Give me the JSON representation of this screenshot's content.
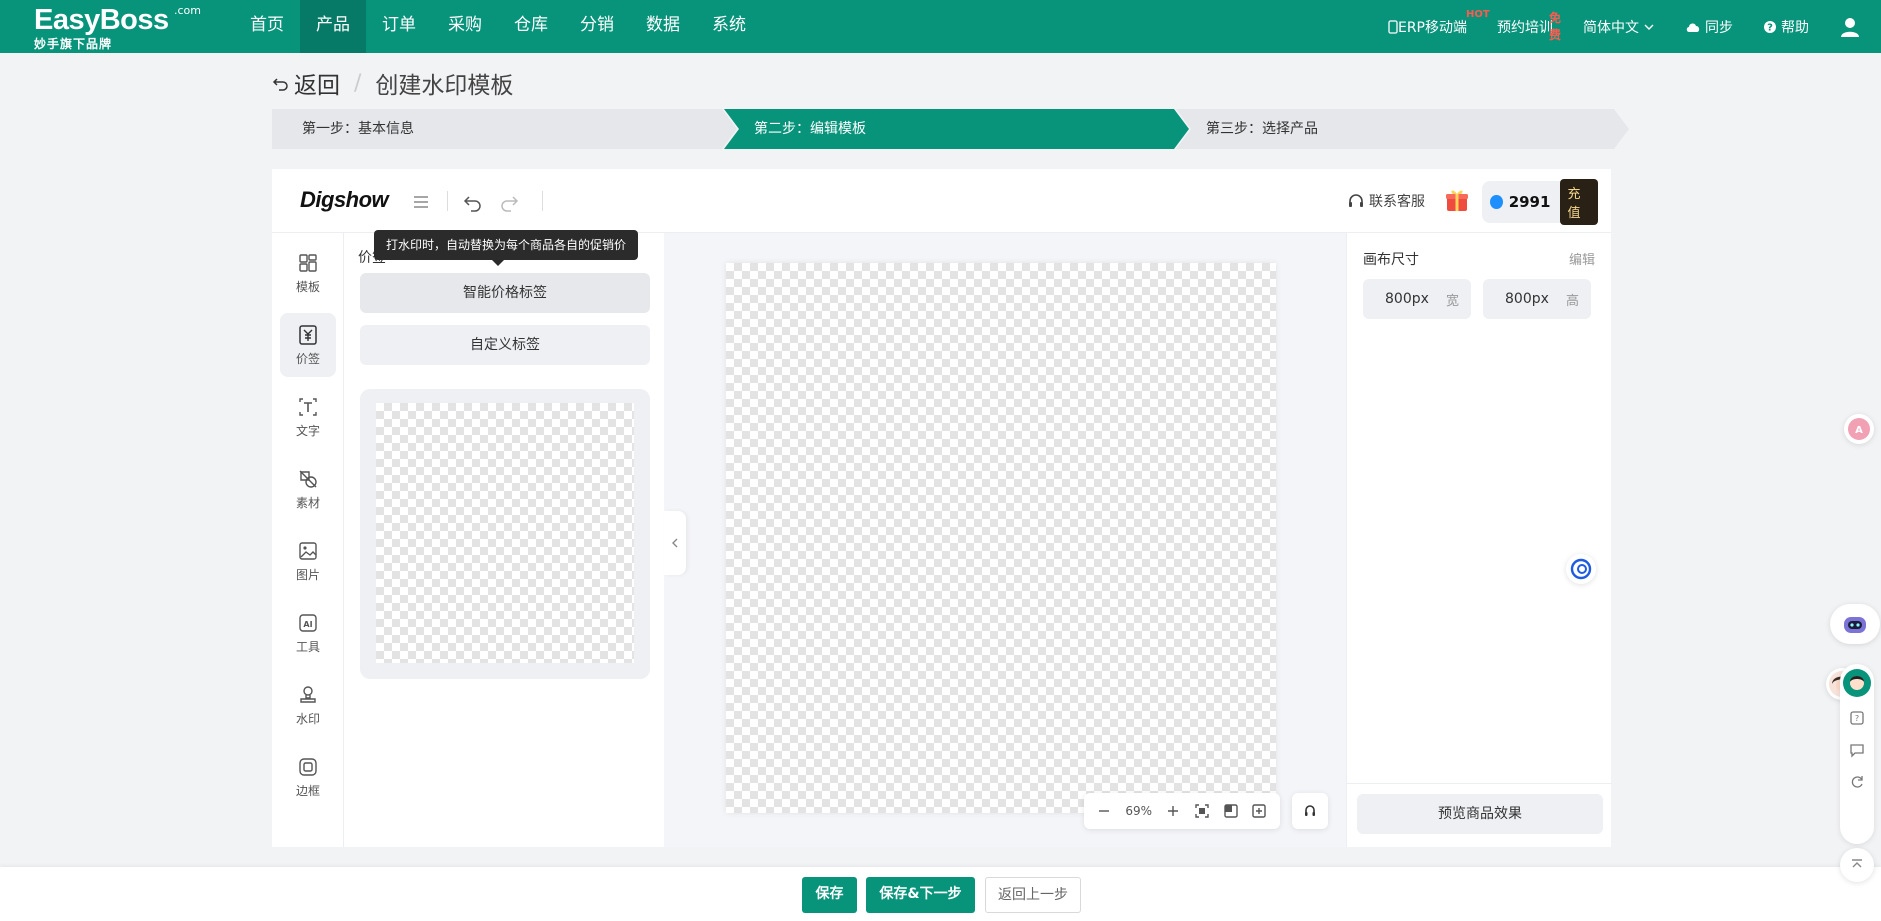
{
  "nav": {
    "logo": "EasyBoss",
    "logo_com": ".com",
    "logo_sub": "妙手旗下品牌",
    "items": [
      {
        "label": "首页"
      },
      {
        "label": "产品"
      },
      {
        "label": "订单"
      },
      {
        "label": "采购"
      },
      {
        "label": "仓库"
      },
      {
        "label": "分销"
      },
      {
        "label": "数据"
      },
      {
        "label": "系统"
      }
    ],
    "active_index": 1,
    "right": {
      "erp_mobile": "ERP移动端",
      "erp_badge": "HOT",
      "training": "预约培训",
      "training_badge": "免费",
      "language": "简体中文",
      "sync": "同步",
      "help": "帮助"
    }
  },
  "header": {
    "back": "返回",
    "separator": "/",
    "title": "创建水印模板"
  },
  "steps": [
    {
      "label": "第一步：基本信息"
    },
    {
      "label": "第二步：编辑模板"
    },
    {
      "label": "第三步：选择产品"
    }
  ],
  "active_step": 1,
  "editor": {
    "logo": "Digshow",
    "contact": "联系客服",
    "credits": "2991",
    "recharge": "充值",
    "rail": [
      {
        "label": "模板",
        "icon": "template-icon"
      },
      {
        "label": "价签",
        "icon": "price-tag-icon"
      },
      {
        "label": "文字",
        "icon": "text-icon"
      },
      {
        "label": "素材",
        "icon": "material-icon"
      },
      {
        "label": "图片",
        "icon": "image-icon"
      },
      {
        "label": "工具",
        "icon": "ai-tool-icon"
      },
      {
        "label": "水印",
        "icon": "watermark-icon"
      },
      {
        "label": "边框",
        "icon": "border-icon"
      }
    ],
    "active_rail": 1,
    "panel": {
      "title": "价签",
      "tooltip": "打水印时，自动替换为每个商品各自的促销价",
      "btn_smart": "智能价格标签",
      "btn_custom": "自定义标签"
    },
    "zoom": "69%",
    "right": {
      "title": "画布尺寸",
      "edit": "编辑",
      "width_value": "800px",
      "width_unit": "宽",
      "height_value": "800px",
      "height_unit": "高",
      "preview": "预览商品效果"
    }
  },
  "footer": {
    "save": "保存",
    "save_next": "保存&下一步",
    "back_prev": "返回上一步"
  },
  "colors": {
    "brand": "#08937b",
    "brand_dark": "#067a66"
  }
}
